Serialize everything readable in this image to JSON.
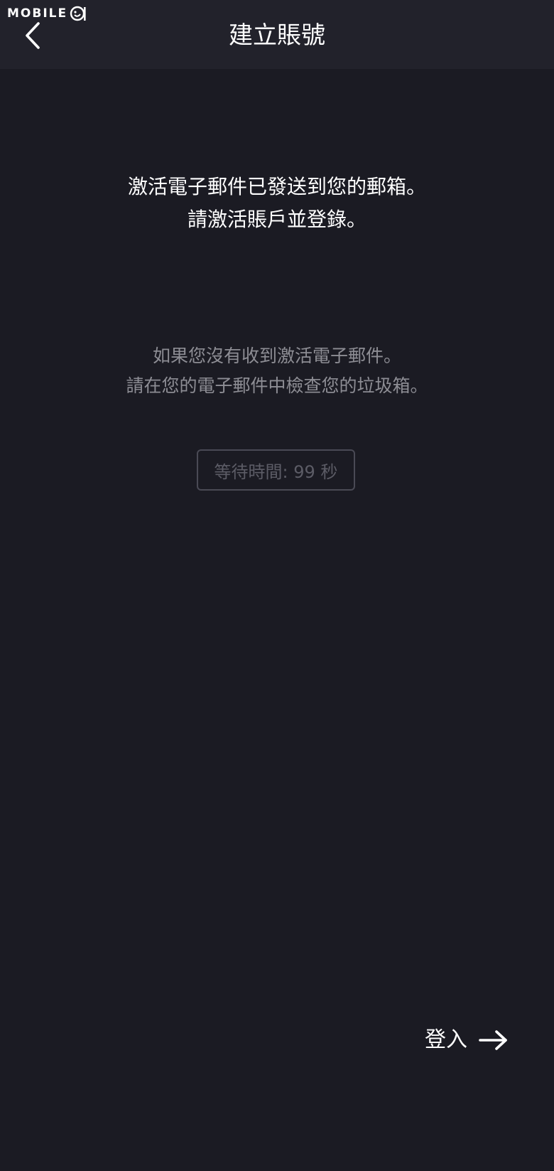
{
  "watermark": {
    "text": "MOBILE"
  },
  "header": {
    "title": "建立賬號",
    "back_icon": "chevron-left-icon"
  },
  "message": {
    "line1": "激活電子郵件已發送到您的郵箱。",
    "line2": "請激活賬戶並登錄。"
  },
  "hint": {
    "line1": "如果您沒有收到激活電子郵件。",
    "line2": "請在您的電子郵件中檢查您的垃圾箱。"
  },
  "wait_button": {
    "label": "等待時間: 99 秒"
  },
  "login": {
    "label": "登入",
    "icon": "arrow-right-icon"
  },
  "colors": {
    "background": "#1b1b23",
    "header": "#22222b",
    "hint_text": "#8d8d94",
    "disabled_text": "#5c5c66",
    "disabled_border": "#4a4a55"
  }
}
